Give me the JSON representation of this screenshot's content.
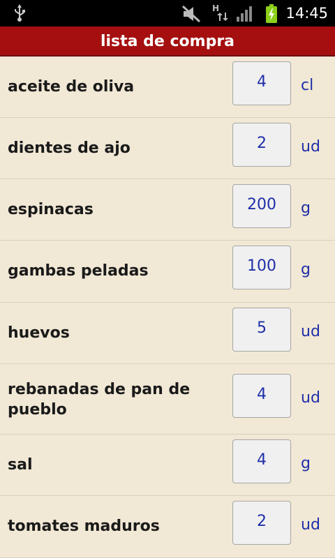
{
  "status_bar": {
    "time": "14:45",
    "icons": [
      "usb-icon",
      "mute-icon",
      "h-data-icon",
      "signal-icon",
      "battery-charging-icon"
    ]
  },
  "title": "lista de compra",
  "items": [
    {
      "name": "aceite de oliva",
      "qty": "4",
      "unit": "cl"
    },
    {
      "name": "dientes de ajo",
      "qty": "2",
      "unit": "ud"
    },
    {
      "name": "espinacas",
      "qty": "200",
      "unit": "g"
    },
    {
      "name": "gambas peladas",
      "qty": "100",
      "unit": "g"
    },
    {
      "name": "huevos",
      "qty": "5",
      "unit": "ud"
    },
    {
      "name": "rebanadas de pan de pueblo",
      "qty": "4",
      "unit": "ud"
    },
    {
      "name": "sal",
      "qty": "4",
      "unit": "g"
    },
    {
      "name": "tomates maduros",
      "qty": "2",
      "unit": "ud"
    }
  ],
  "colors": {
    "title_bar": "#a50f0f",
    "background": "#f1e8d5",
    "value_text": "#1f2fa8",
    "battery": "#8ccf1a"
  }
}
